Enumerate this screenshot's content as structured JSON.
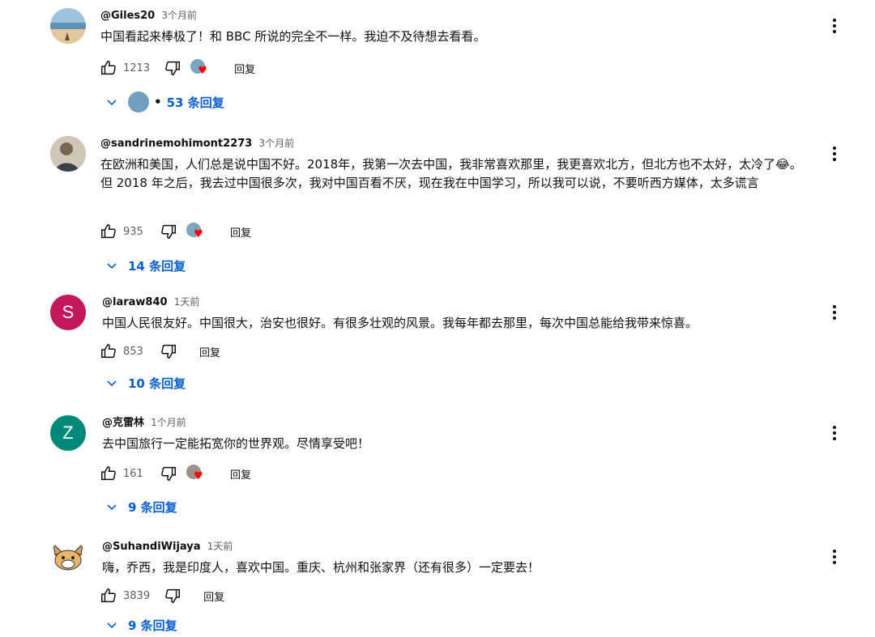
{
  "comments": [
    {
      "author": "@Giles20",
      "time": "3个月前",
      "text": "中国看起来棒极了！和 BBC 所说的完全不一样。我迫不及待想去看看。",
      "likes": "1213",
      "reply_label": "回复",
      "replies": "53 条回复",
      "avatar": {
        "type": "photo",
        "color": "#c9a97e"
      }
    },
    {
      "author": "@sandrinemohimont2273",
      "time": "3个月前",
      "text": "在欧洲和美国，人们总是说中国不好。2018年，我第一次去中国，我非常喜欢那里，我更喜欢北方，但北方也不太好，太冷了😂。但 2018 年之后，我去过中国很多次，我对中国百看不厌，现在我在中国学习，所以我可以说，不要听西方媒体，太多谎言",
      "likes": "935",
      "reply_label": "回复",
      "replies": "14 条回复",
      "avatar": {
        "type": "photo",
        "color": "#8f8478"
      }
    },
    {
      "author": "@laraw840",
      "time": "1天前",
      "text": "中国人民很友好。中国很大，治安也很好。有很多壮观的风景。我每年都去那里，每次中国总能给我带来惊喜。",
      "likes": "853",
      "reply_label": "回复",
      "replies": "10 条回复",
      "avatar": {
        "type": "letter",
        "letter": "S",
        "color": "#c2185b"
      }
    },
    {
      "author": "@克雷林",
      "time": "1个月前",
      "text": "去中国旅行一定能拓宽你的世界观。尽情享受吧！",
      "likes": "161",
      "reply_label": "回复",
      "replies": "9 条回复",
      "avatar": {
        "type": "letter",
        "letter": "Z",
        "color": "#00897b"
      }
    },
    {
      "author": "@SuhandiWijaya",
      "time": "1天前",
      "text": "嗨，乔西，我是印度人，喜欢中国。重庆、杭州和张家界（还有很多）一定要去！",
      "likes": "3839",
      "reply_label": "回复",
      "replies": "9 条回复",
      "avatar": {
        "type": "cartoon",
        "color": "#d9a05b"
      }
    }
  ],
  "icons": {
    "like": "thumb-up-icon",
    "dislike": "thumb-down-icon",
    "heart": "heart-icon",
    "menu": "more-vert-icon",
    "expand": "chevron-down-icon"
  },
  "colors": {
    "link": "#065fd4",
    "meta": "#606060",
    "heart": "#ff0000"
  }
}
